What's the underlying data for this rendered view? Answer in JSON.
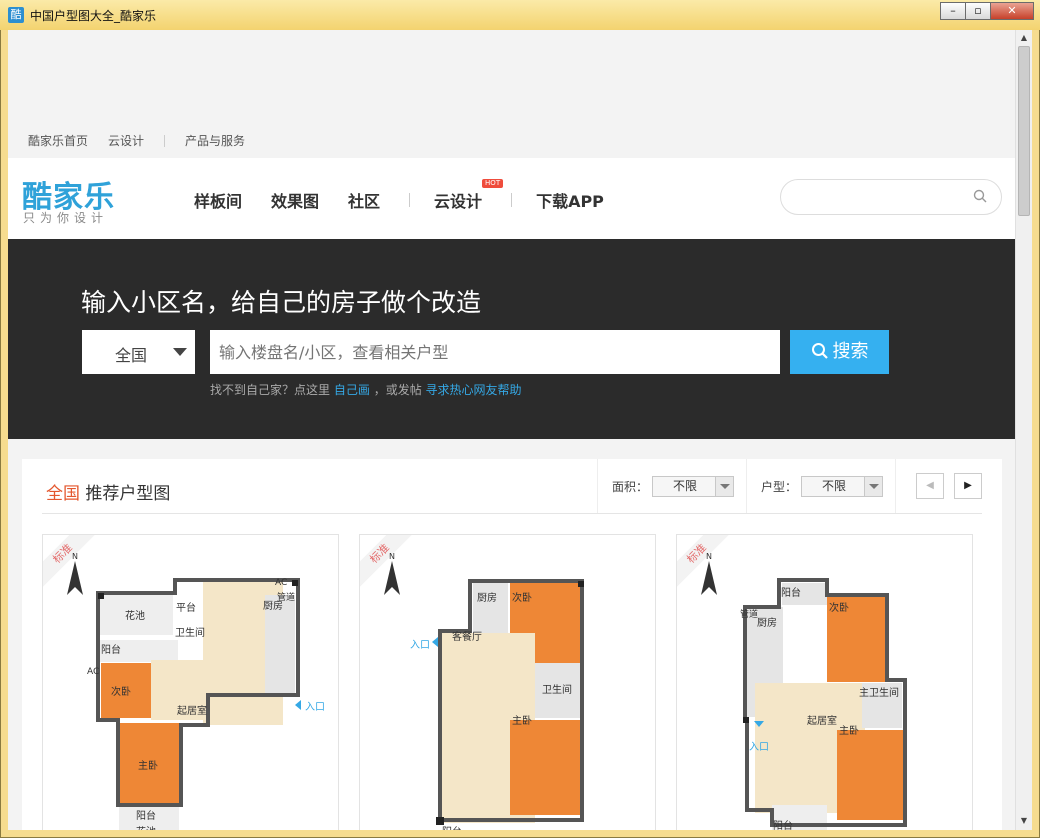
{
  "window": {
    "title": "中国户型图大全_酷家乐",
    "app_icon": "酷"
  },
  "toplinks": [
    "酷家乐首页",
    "云设计",
    "产品与服务"
  ],
  "header": {
    "logo": "酷家乐",
    "slogan": "只为你设计",
    "nav": [
      "样板间",
      "效果图",
      "社区",
      "云设计",
      "下载APP"
    ],
    "hot_badge": "HOT",
    "search_placeholder": ""
  },
  "hero": {
    "title": "输入小区名，给自己的房子做个改造",
    "region": "全国",
    "input_placeholder": "输入楼盘名/小区，查看相关户型",
    "search_button": "搜索",
    "hint_prefix": "找不到自己家？点这里",
    "hint_link1": "自己画",
    "hint_middle": "，或发帖",
    "hint_link2": "寻求热心网友帮助"
  },
  "panel": {
    "title_prefix": "全国",
    "title": "推荐户型图",
    "filter_area_label": "面积：",
    "filter_area_value": "不限",
    "filter_type_label": "户型：",
    "filter_type_value": "不限",
    "prev_icon": "chevron-left-icon",
    "next_icon": "chevron-right-icon"
  },
  "cards": [
    {
      "ribbon": "标准",
      "rooms": [
        "花池",
        "平台",
        "AC",
        "管道",
        "厨房",
        "卫生间",
        "阳台",
        "AC",
        "次卧",
        "起居室",
        "入口",
        "主卧",
        "阳台",
        "花池"
      ]
    },
    {
      "ribbon": "标准",
      "rooms": [
        "厨房",
        "次卧",
        "客餐厅",
        "入口",
        "卫生间",
        "主卧",
        "阳台"
      ]
    },
    {
      "ribbon": "标准",
      "rooms": [
        "阳台",
        "管道",
        "厨房",
        "次卧",
        "主卫生间",
        "起居室",
        "入口",
        "主卧",
        "阳台"
      ]
    }
  ],
  "colors": {
    "accent_blue": "#35b0f0",
    "hero_bg": "#2b2b2b",
    "red": "#e4572e",
    "floor_orange": "#f0a064",
    "bedroom_orange": "#ee8736"
  }
}
